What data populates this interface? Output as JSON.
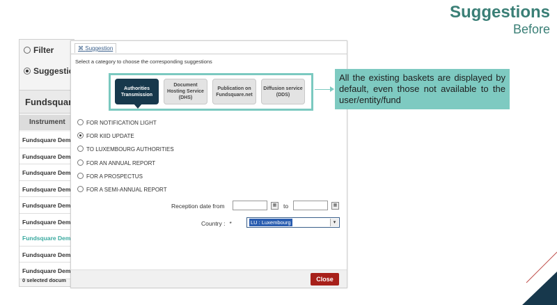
{
  "slide": {
    "title": "Suggestions",
    "subtitle": "Before"
  },
  "background_panel": {
    "filter_label": "Filter",
    "suggestion_label": "Suggestion",
    "fund_header": "Fundsquare",
    "column_header": "Instrument",
    "rows": [
      "Fundsquare Dem",
      "Fundsquare Dem",
      "Fundsquare Dem",
      "Fundsquare Dem",
      "Fundsquare Dem",
      "Fundsquare Dem",
      "Fundsquare Dem",
      "Fundsquare Dem",
      "Fundsquare Dem"
    ],
    "selected_row": 6,
    "selected_count": "0 selected docum"
  },
  "dialog": {
    "tab_label": "Suggestion",
    "instruction": "Select a category to choose the corresponding suggestions",
    "categories": [
      {
        "label": "Authorities Transmission",
        "active": true
      },
      {
        "label": "Document Hosting Service (DHS)",
        "active": false
      },
      {
        "label": "Publication on Fundsquare.net",
        "active": false
      },
      {
        "label": "Diffusion service (DDS)",
        "active": false
      }
    ],
    "options": [
      {
        "label": "FOR NOTIFICATION LIGHT",
        "checked": false
      },
      {
        "label": "FOR KIID UPDATE",
        "checked": true
      },
      {
        "label": "TO LUXEMBOURG AUTHORITIES",
        "checked": false
      },
      {
        "label": "FOR AN ANNUAL REPORT",
        "checked": false
      },
      {
        "label": "FOR A PROSPECTUS",
        "checked": false
      },
      {
        "label": "FOR A SEMI-ANNUAL REPORT",
        "checked": false
      }
    ],
    "reception_label": "Reception date from",
    "to_label": "to",
    "country_label": "Country :",
    "required_mark": "*",
    "country_value": "LU : Luxembourg",
    "close_label": "Close"
  },
  "callout": {
    "text": "All the existing baskets are displayed by default, even those not available to the user/entity/fund"
  },
  "colors": {
    "accent_teal": "#7ecac1",
    "title_green": "#3a7f76",
    "active_category": "#17384c",
    "close_button": "#a7201a"
  }
}
